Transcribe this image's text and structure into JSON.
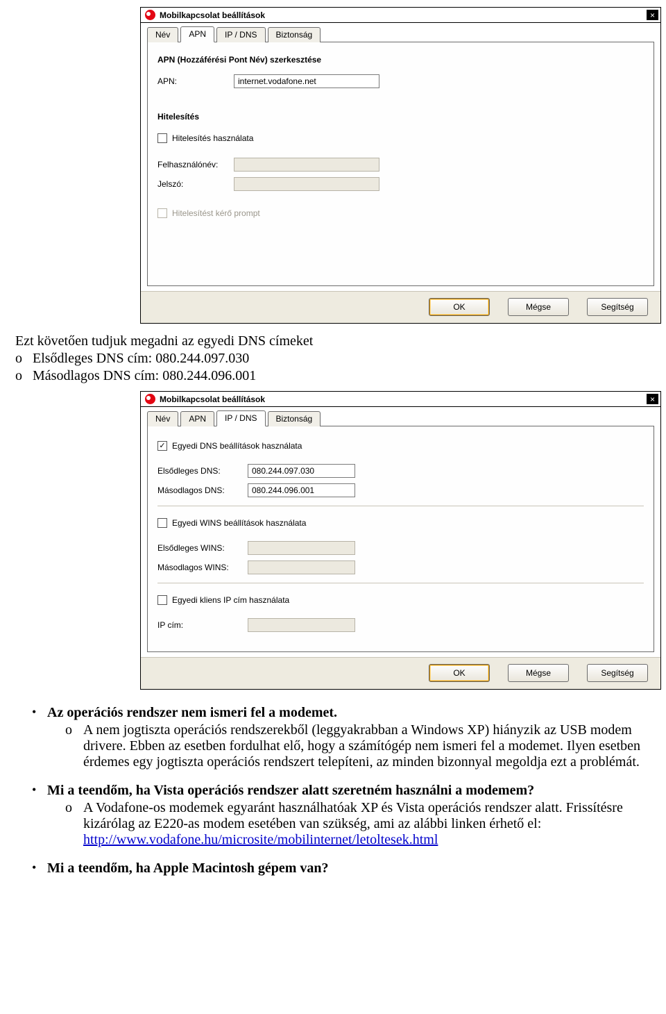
{
  "dialog1": {
    "title": "Mobilkapcsolat beállítások",
    "tabs": [
      "Név",
      "APN",
      "IP / DNS",
      "Biztonság"
    ],
    "active_tab": 1,
    "section1_heading": "APN (Hozzáférési Pont Név) szerkesztése",
    "apn_label": "APN:",
    "apn_value": "internet.vodafone.net",
    "section2_heading": "Hitelesítés",
    "use_auth_label": "Hitelesítés használata",
    "use_auth_checked": false,
    "user_label": "Felhasználónév:",
    "user_value": "",
    "pass_label": "Jelszó:",
    "pass_value": "",
    "prompt_label": "Hitelesítést kérő prompt",
    "prompt_checked": false,
    "buttons": {
      "ok": "OK",
      "cancel": "Mégse",
      "help": "Segítség"
    }
  },
  "doc": {
    "intro": "Ezt követően tudjuk megadni az egyedi DNS címeket",
    "dns_primary_label": "Elsődleges DNS cím: 080.244.097.030",
    "dns_secondary_label": "Másodlagos DNS cím: 080.244.096.001"
  },
  "dialog2": {
    "title": "Mobilkapcsolat beállítások",
    "tabs": [
      "Név",
      "APN",
      "IP / DNS",
      "Biztonság"
    ],
    "active_tab": 2,
    "use_dns_label": "Egyedi DNS beállítások használata",
    "use_dns_checked": true,
    "dns1_label": "Elsődleges DNS:",
    "dns1_value": "080.244.097.030",
    "dns2_label": "Másodlagos DNS:",
    "dns2_value": "080.244.096.001",
    "use_wins_label": "Egyedi WINS beállítások használata",
    "use_wins_checked": false,
    "wins1_label": "Elsődleges WINS:",
    "wins1_value": "",
    "wins2_label": "Másodlagos WINS:",
    "wins2_value": "",
    "use_ip_label": "Egyedi kliens IP cím használata",
    "use_ip_checked": false,
    "ip_label": "IP cím:",
    "ip_value": "",
    "buttons": {
      "ok": "OK",
      "cancel": "Mégse",
      "help": "Segítség"
    }
  },
  "faq": {
    "q1": "Az operációs rendszer nem ismeri fel a modemet.",
    "a1": "A nem jogtiszta operációs rendszerekből (leggyakrabban a Windows XP) hiányzik az USB modem drivere. Ebben az esetben fordulhat elő, hogy a számítógép nem ismeri fel a modemet. Ilyen esetben érdemes egy jogtiszta operációs rendszert telepíteni, az minden bizonnyal megoldja ezt a problémát.",
    "q2": "Mi a teendőm, ha Vista operációs rendszer alatt szeretném használni a modemem?",
    "a2_pre": "A Vodafone-os modemek egyaránt használhatóak XP és Vista operációs rendszer alatt. Frissítésre kizárólag az E220-as modem esetében van szükség, ami az alábbi linken érhető el: ",
    "a2_link": "http://www.vodafone.hu/microsite/mobilinternet/letoltesek.html",
    "q3": "Mi a teendőm, ha Apple Macintosh gépem van?"
  }
}
